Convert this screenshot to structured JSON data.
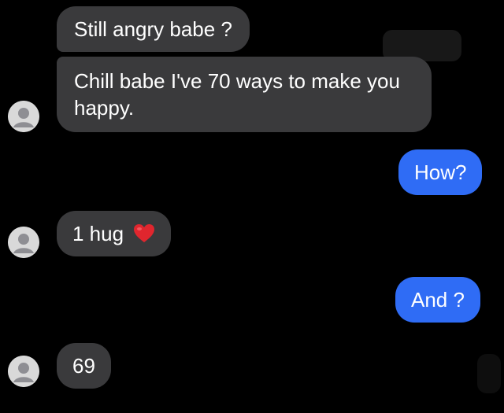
{
  "chat": {
    "messages": [
      {
        "sender": "them",
        "text": "Still angry babe ?"
      },
      {
        "sender": "them",
        "text": "Chill babe I've 70 ways to make you happy."
      },
      {
        "sender": "me",
        "text": "How?"
      },
      {
        "sender": "them",
        "text": "1 hug",
        "emoji_icon": "red-heart-icon"
      },
      {
        "sender": "me",
        "text": "And ?"
      },
      {
        "sender": "them",
        "text": "69"
      }
    ]
  },
  "colors": {
    "background": "#000000",
    "incoming_bubble": "#3a3a3c",
    "outgoing_bubble": "#2f6cf5",
    "text": "#ffffff",
    "heart": "#e0262e"
  }
}
